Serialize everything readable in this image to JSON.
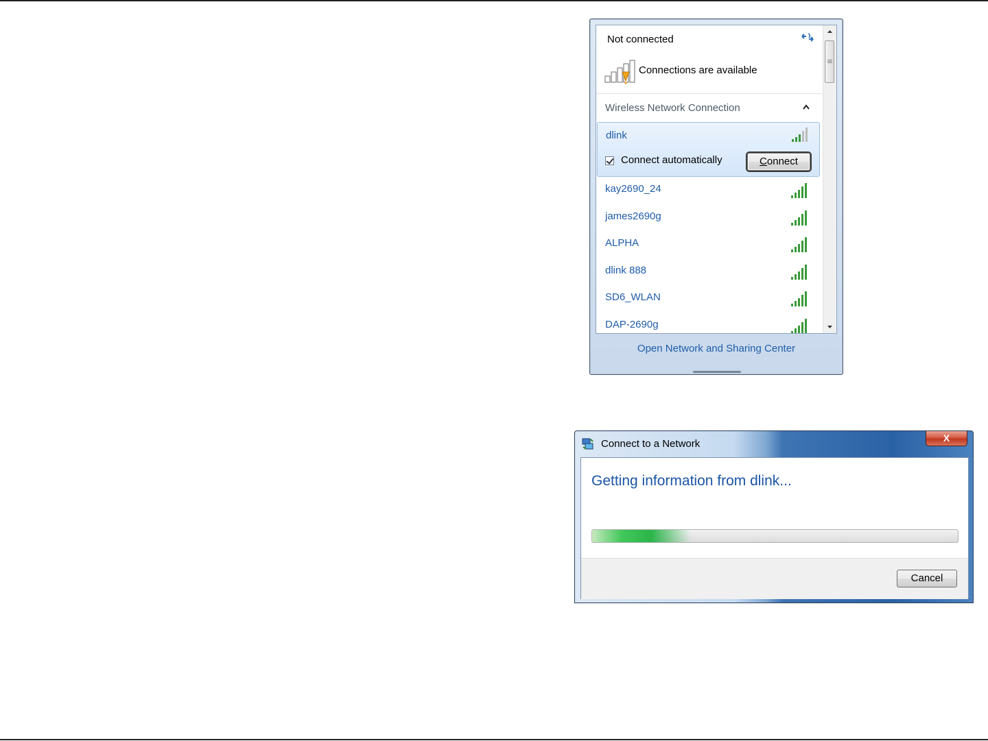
{
  "flyout": {
    "status_title": "Not connected",
    "status_subtitle": "Connections are available",
    "section_title": "Wireless Network Connection",
    "selected_network": {
      "name": "dlink",
      "connect_automatically_label": "Connect automatically",
      "connect_automatically_checked": true,
      "connect_button_label": "Connect",
      "connect_button_mnemonic": "C"
    },
    "networks": [
      {
        "name": "kay2690_24"
      },
      {
        "name": "james2690g"
      },
      {
        "name": "ALPHA"
      },
      {
        "name": "dlink 888"
      },
      {
        "name": "SD6_WLAN"
      },
      {
        "name": "DAP-2690g"
      }
    ],
    "footer_link": "Open Network and Sharing Center",
    "colors": {
      "link": "#1f5da8",
      "signal": "#3a9a3a",
      "signal_dim": "#9a9a9a"
    }
  },
  "dialog": {
    "title": "Connect to a Network",
    "close_label": "X",
    "heading": "Getting information from dlink...",
    "progress": 0.27,
    "cancel_label": "Cancel"
  }
}
